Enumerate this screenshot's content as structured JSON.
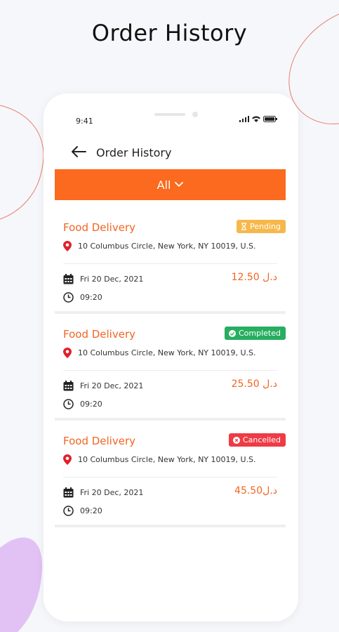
{
  "headline": "Order History",
  "status_bar": {
    "time": "9:41"
  },
  "app_bar": {
    "title": "Order History"
  },
  "filter": {
    "label": "All"
  },
  "orders": [
    {
      "service": "Food Delivery",
      "status": "Pending",
      "status_color": "#f6b84b",
      "address": "10 Columbus Circle, New York, NY 10019, U.S.",
      "date": "Fri 20 Dec, 2021",
      "time": "09:20",
      "price": "د.ل 12.50"
    },
    {
      "service": "Food Delivery",
      "status": "Completed",
      "status_color": "#27ae60",
      "address": "10 Columbus Circle, New York, NY 10019, U.S.",
      "date": "Fri 20 Dec, 2021",
      "time": "09:20",
      "price": "د.ل 25.50"
    },
    {
      "service": "Food Delivery",
      "status": "Cancelled",
      "status_color": "#ee3b45",
      "address": "10 Columbus Circle, New York, NY 10019, U.S.",
      "date": "Fri 20 Dec, 2021",
      "time": "09:20",
      "price": "د.ل45.50"
    }
  ],
  "colors": {
    "accent": "#fb6a1e",
    "service_text": "#f26522",
    "background": "#f6f7fb"
  }
}
